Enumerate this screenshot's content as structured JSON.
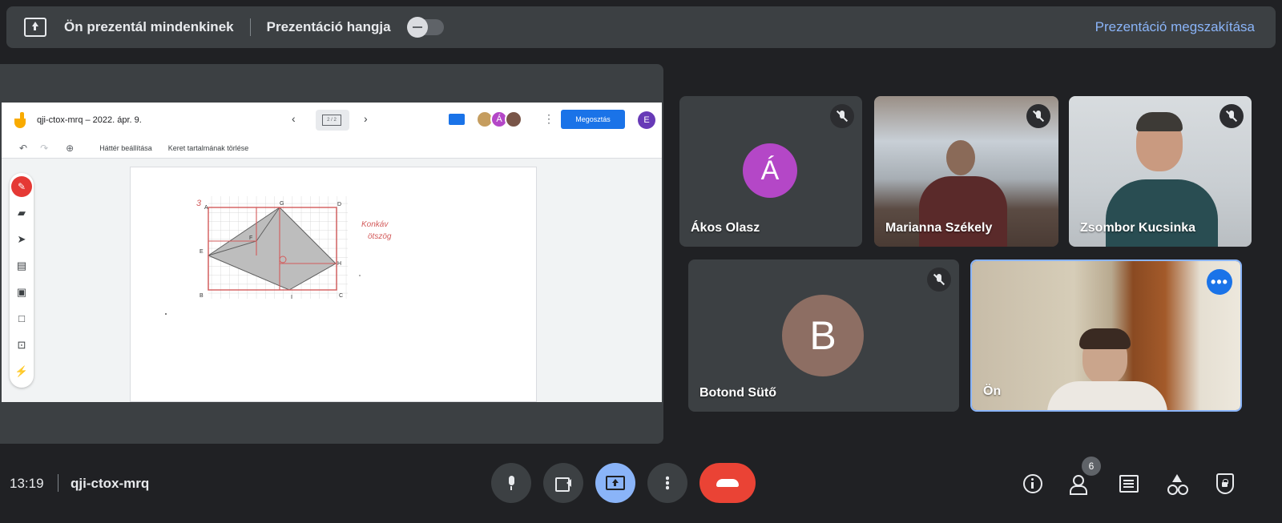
{
  "banner": {
    "presenting_text": "Ön prezentál mindenkinek",
    "audio_label": "Prezentáció hangja",
    "stop_label": "Prezentáció megszakítása"
  },
  "jamboard": {
    "title": "qji-ctox-mrq – 2022. ápr. 9.",
    "frame_counter": "2 / 2",
    "share_label": "Megosztás",
    "user_initial": "E",
    "avatar_initial": "Á",
    "set_background_label": "Háttér beállítása",
    "clear_frame_label": "Keret tartalmának törlése",
    "handwriting": [
      "Konkáv",
      "ötszög"
    ],
    "point_labels": [
      "A",
      "G",
      "D",
      "E",
      "F",
      "H",
      "B",
      "I",
      "C"
    ],
    "exercise_number": "3"
  },
  "participants": [
    {
      "name": "Ákos Olasz",
      "initial": "Á",
      "color": "#b447c7",
      "muted": true
    },
    {
      "name": "Marianna Székely",
      "muted": true
    },
    {
      "name": "Zsombor Kucsinka",
      "muted": true
    },
    {
      "name": "Botond Sütő",
      "initial": "B",
      "color": "#8d6e63",
      "muted": true
    },
    {
      "name": "Ön",
      "self": true
    }
  ],
  "bottom": {
    "time": "13:19",
    "meeting_code": "qji-ctox-mrq",
    "participant_count": "6"
  }
}
